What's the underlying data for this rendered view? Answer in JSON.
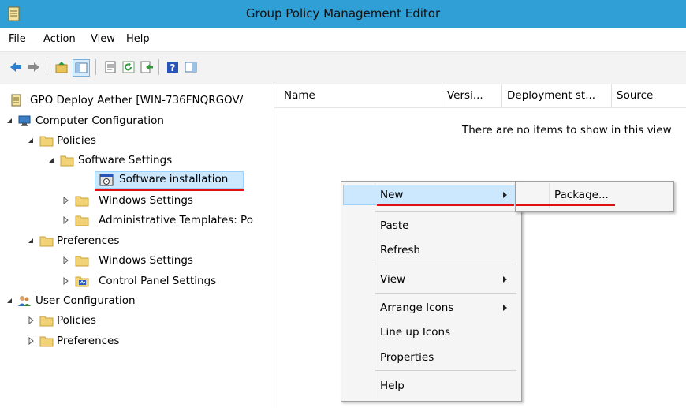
{
  "window": {
    "title": "Group Policy Management Editor"
  },
  "menubar": {
    "file": "File",
    "action": "Action",
    "view": "View",
    "help": "Help"
  },
  "toolbar": {
    "buttons": [
      "back-icon",
      "forward-icon",
      "up-folder-icon",
      "show-hide-tree-icon",
      "properties-icon",
      "refresh-icon",
      "export-list-icon",
      "help-icon",
      "show-hide-action-pane-icon"
    ]
  },
  "tree": {
    "root": "GPO Deploy Aether [WIN-736FNQRGOV/",
    "computer_configuration": "Computer Configuration",
    "policies": "Policies",
    "software_settings": "Software Settings",
    "software_installation": "Software installation",
    "windows_settings": "Windows Settings",
    "administrative_templates": "Administrative Templates: Po",
    "preferences": "Preferences",
    "pref_windows_settings": "Windows Settings",
    "control_panel_settings": "Control Panel Settings",
    "user_configuration": "User Configuration",
    "user_policies": "Policies",
    "user_preferences": "Preferences"
  },
  "list": {
    "columns": [
      "Name",
      "Versi...",
      "Deployment st...",
      "Source"
    ],
    "empty_message": "There are no items to show in this view"
  },
  "context_menu": {
    "new": "New",
    "paste": "Paste",
    "refresh": "Refresh",
    "view": "View",
    "arrange_icons": "Arrange Icons",
    "line_up_icons": "Line up Icons",
    "properties": "Properties",
    "help": "Help"
  },
  "submenu": {
    "package": "Package..."
  },
  "colors": {
    "titlebar": "#2f9fd6",
    "highlight": "#cce8ff",
    "annotation_red": "#e01010"
  }
}
